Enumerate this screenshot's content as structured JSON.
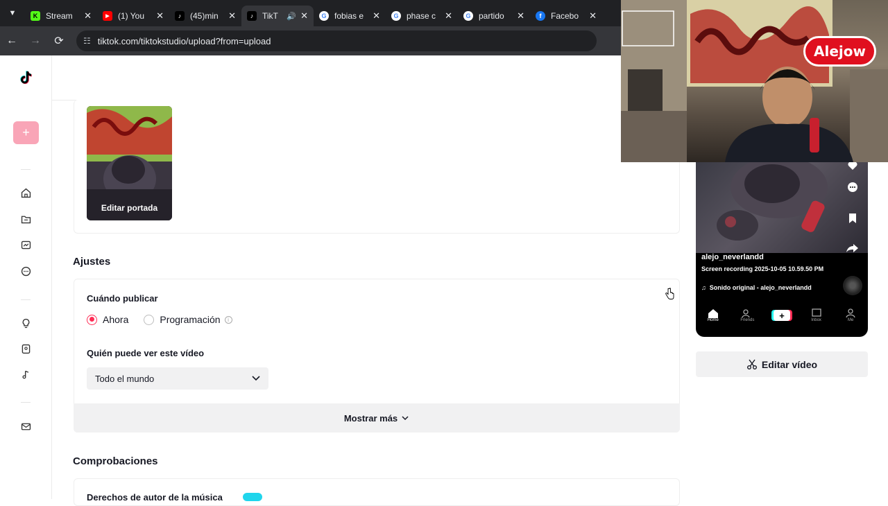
{
  "browser": {
    "tabs": [
      {
        "label": "Stream",
        "favicon": "kick-icon",
        "color": "#53fc18",
        "active": false
      },
      {
        "label": "(1) You",
        "favicon": "youtube-icon",
        "color": "#ff0000",
        "active": false
      },
      {
        "label": "(45)min",
        "favicon": "tiktok-icon",
        "color": "#000000",
        "active": false
      },
      {
        "label": "TikT",
        "favicon": "tiktok-icon",
        "color": "#000000",
        "active": true
      },
      {
        "label": "fobias e",
        "favicon": "google-icon",
        "color": "#ffffff",
        "active": false
      },
      {
        "label": "phase c",
        "favicon": "google-icon",
        "color": "#ffffff",
        "active": false
      },
      {
        "label": "partido",
        "favicon": "google-icon",
        "color": "#ffffff",
        "active": false
      },
      {
        "label": "Facebo",
        "favicon": "facebook-icon",
        "color": "#1877f2",
        "active": false
      }
    ],
    "url": "tiktok.com/tiktokstudio/upload?from=upload"
  },
  "cover": {
    "label": "Editar portada"
  },
  "settings": {
    "title": "Ajustes",
    "when_label": "Cuándo publicar",
    "option_now": "Ahora",
    "option_schedule": "Programación",
    "who_label": "Quién puede ver este vídeo",
    "who_value": "Todo el mundo",
    "show_more": "Mostrar más"
  },
  "checks": {
    "title": "Comprobaciones",
    "music_rights": "Derechos de autor de la música"
  },
  "preview": {
    "username": "alejo_neverlandd",
    "caption": "Screen recording 2025-10-05 10.59.50 PM",
    "sound": "Sonido original - alejo_neverlandd",
    "nav": [
      "Home",
      "Friends",
      "",
      "Inbox",
      "Me"
    ]
  },
  "edit_video": "Editar vídeo",
  "overlay": {
    "name": "Alejow"
  },
  "colors": {
    "accent": "#fe2c55",
    "upload_button": "#f9a5b7",
    "toggle": "#20d5ec"
  }
}
